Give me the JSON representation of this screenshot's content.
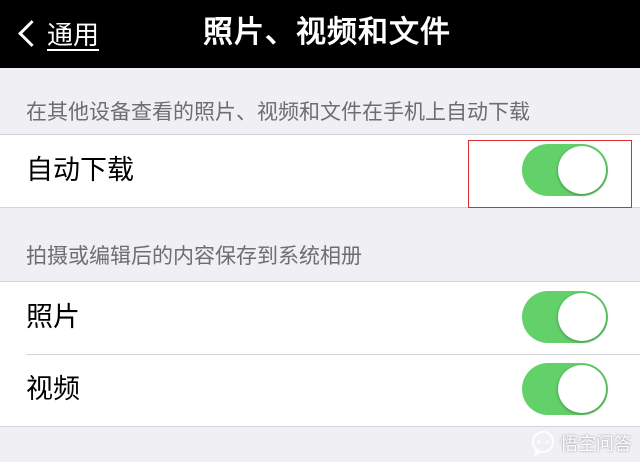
{
  "nav": {
    "back_label": "通用",
    "title": "照片、视频和文件"
  },
  "sections": [
    {
      "header": "在其他设备查看的照片、视频和文件在手机上自动下载",
      "rows": [
        {
          "label": "自动下载",
          "toggle_on": true
        }
      ]
    },
    {
      "header": "拍摄或编辑后的内容保存到系统相册",
      "rows": [
        {
          "label": "照片",
          "toggle_on": true
        },
        {
          "label": "视频",
          "toggle_on": true
        }
      ]
    }
  ],
  "watermark": {
    "text": "悟空问答",
    "icon": "chat-bubble-icon"
  },
  "colors": {
    "nav_background": "#000000",
    "page_background": "#efeff4",
    "toggle_on": "#63d16a",
    "highlight": "#d92e2e",
    "section_header_text": "#6d6d72"
  }
}
